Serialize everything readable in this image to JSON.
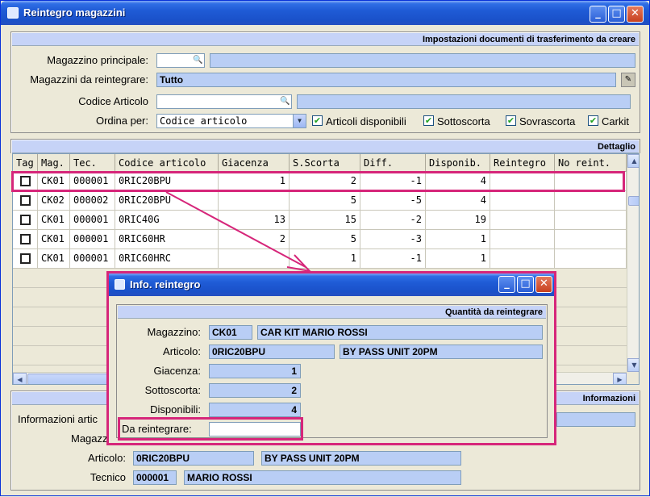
{
  "window": {
    "title": "Reintegro magazzini"
  },
  "top_section": {
    "header": "Impostazioni documenti di trasferimento da creare",
    "magazzino_principale_label": "Magazzino principale:",
    "magazzini_reintegrare_label": "Magazzini da reintegrare:",
    "magazzini_reintegrare_value": "Tutto",
    "codice_articolo_label": "Codice Articolo",
    "ordina_per_label": "Ordina per:",
    "ordina_per_value": "Codice articolo",
    "checkboxes": [
      {
        "label": "Articoli disponibili",
        "checked": true
      },
      {
        "label": "Sottoscorta",
        "checked": true
      },
      {
        "label": "Sovrascorta",
        "checked": true
      },
      {
        "label": "Carkit",
        "checked": true
      }
    ]
  },
  "table": {
    "header": "Dettaglio",
    "columns": [
      "Tag",
      "Mag.",
      "Tec.",
      "Codice articolo",
      "Giacenza",
      "S.Scorta",
      "Diff.",
      "Disponib.",
      "Reintegro",
      "No reint."
    ],
    "rows": [
      {
        "mag": "CK01",
        "tec": "000001",
        "codice": "0RIC20BPU",
        "giacenza": "1",
        "sscorta": "2",
        "diff": "-1",
        "dispon": "4"
      },
      {
        "mag": "CK02",
        "tec": "000002",
        "codice": "0RIC20BPU",
        "giacenza": "",
        "sscorta": "5",
        "diff": "-5",
        "dispon": "4"
      },
      {
        "mag": "CK01",
        "tec": "000001",
        "codice": "0RIC40G",
        "giacenza": "13",
        "sscorta": "15",
        "diff": "-2",
        "dispon": "19"
      },
      {
        "mag": "CK01",
        "tec": "000001",
        "codice": "0RIC60HR",
        "giacenza": "2",
        "sscorta": "5",
        "diff": "-3",
        "dispon": "1"
      },
      {
        "mag": "CK01",
        "tec": "000001",
        "codice": "0RIC60HRC",
        "giacenza": "",
        "sscorta": "1",
        "diff": "-1",
        "dispon": "1"
      }
    ]
  },
  "bottom_section": {
    "header": "Informazioni",
    "info_label": "Informazioni artic",
    "magazz_label": "Magazz",
    "articolo_label": "Articolo:",
    "articolo_code": "0RIC20BPU",
    "articolo_desc": "BY PASS UNIT 20PM",
    "tecnico_label": "Tecnico",
    "tecnico_code": "000001",
    "tecnico_name": "MARIO ROSSI"
  },
  "popup": {
    "title": "Info. reintegro",
    "section_header": "Quantità da reintegrare",
    "magazzino_label": "Magazzino:",
    "magazzino_code": "CK01",
    "magazzino_name": "CAR KIT MARIO ROSSI",
    "articolo_label": "Articolo:",
    "articolo_code": "0RIC20BPU",
    "articolo_desc": "BY PASS UNIT 20PM",
    "giacenza_label": "Giacenza:",
    "giacenza_value": "1",
    "sottoscorta_label": "Sottoscorta:",
    "sottoscorta_value": "2",
    "disponibili_label": "Disponibili:",
    "disponibili_value": "4",
    "da_reintegrare_label": "Da reintegrare:",
    "da_reintegrare_value": ""
  },
  "accent_color": "#d6267a"
}
